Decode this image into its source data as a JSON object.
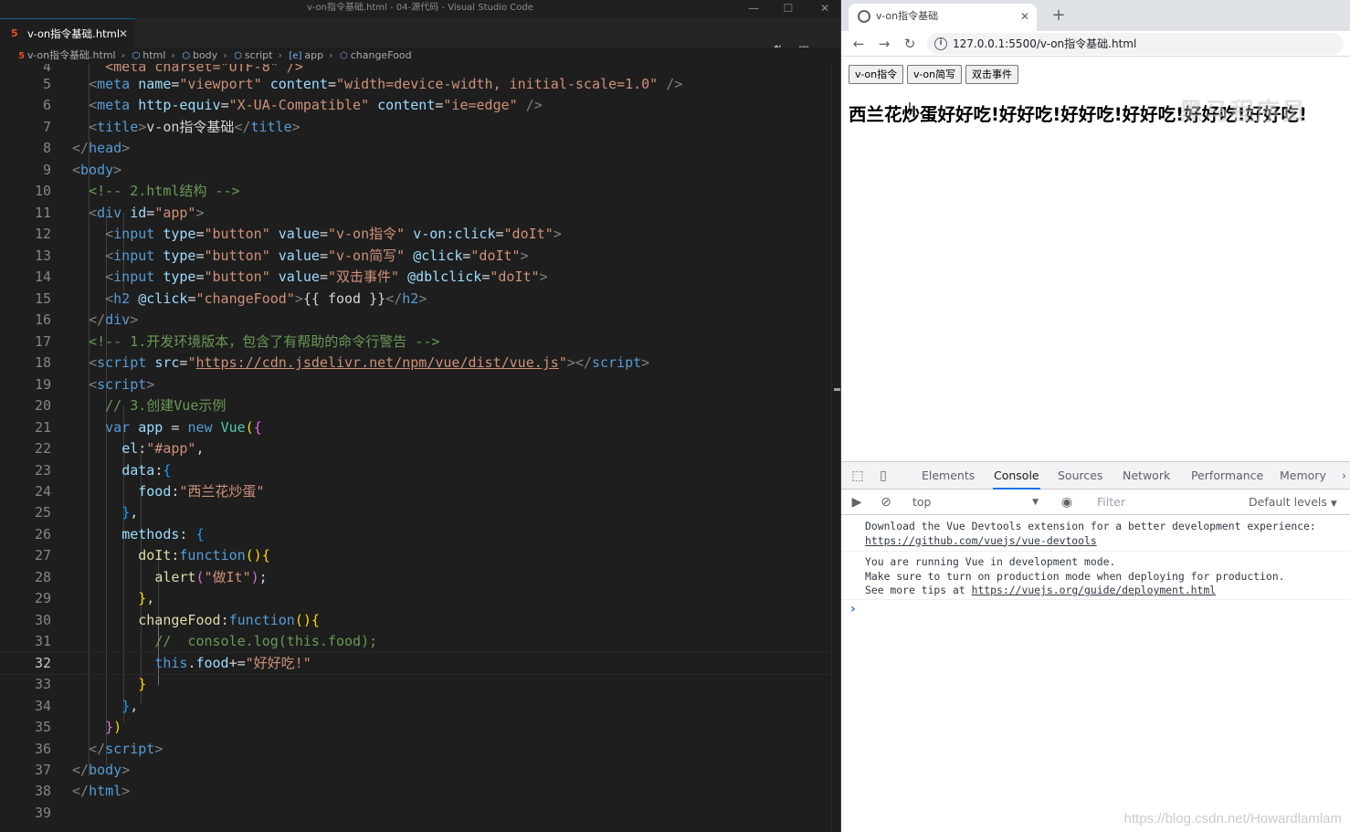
{
  "vscode": {
    "window_title": "v-on指令基础.html - 04-源代码 - Visual Studio Code",
    "tab": {
      "label": "v-on指令基础.html",
      "icon": "html5-icon"
    },
    "breadcrumb": {
      "file": "v-on指令基础.html",
      "html": "html",
      "body": "body",
      "script": "script",
      "app": "app",
      "method": "changeFood"
    },
    "current_line": 32
  },
  "code_lines": [
    {
      "n": "4"
    },
    {
      "n": "5"
    },
    {
      "n": "6"
    },
    {
      "n": "7"
    },
    {
      "n": "8"
    },
    {
      "n": "9"
    },
    {
      "n": "10"
    },
    {
      "n": "11"
    },
    {
      "n": "12"
    },
    {
      "n": "13"
    },
    {
      "n": "14"
    },
    {
      "n": "15"
    },
    {
      "n": "16"
    },
    {
      "n": "17"
    },
    {
      "n": "18"
    },
    {
      "n": "19"
    },
    {
      "n": "20"
    },
    {
      "n": "21"
    },
    {
      "n": "22"
    },
    {
      "n": "23"
    },
    {
      "n": "24"
    },
    {
      "n": "25"
    },
    {
      "n": "26"
    },
    {
      "n": "27"
    },
    {
      "n": "28"
    },
    {
      "n": "29"
    },
    {
      "n": "30"
    },
    {
      "n": "31"
    },
    {
      "n": "32"
    },
    {
      "n": "33"
    },
    {
      "n": "34"
    },
    {
      "n": "35"
    },
    {
      "n": "36"
    },
    {
      "n": "37"
    },
    {
      "n": "38"
    },
    {
      "n": "39"
    }
  ],
  "code_text": {
    "l4": "<meta charset=\"UTF-8\" />",
    "l5_a": "meta",
    "l5_b": "name",
    "l5_c": "\"viewport\"",
    "l5_d": "content",
    "l5_e": "\"width=device-width, initial-scale=1.0\"",
    "l6_a": "meta",
    "l6_b": "http-equiv",
    "l6_c": "\"X-UA-Compatible\"",
    "l6_d": "content",
    "l6_e": "\"ie=edge\"",
    "l7_a": "title",
    "l7_b": "v-on指令基础",
    "l8": "head",
    "l9": "body",
    "l10": "<!-- 2.html结构 -->",
    "l11_a": "div",
    "l11_b": "id",
    "l11_c": "\"app\"",
    "l12_a": "input",
    "l12_b": "type",
    "l12_c": "\"button\"",
    "l12_d": "value",
    "l12_e": "\"v-on指令\"",
    "l12_f": "v-on:click",
    "l12_g": "\"doIt\"",
    "l13_a": "input",
    "l13_b": "type",
    "l13_c": "\"button\"",
    "l13_d": "value",
    "l13_e": "\"v-on简写\"",
    "l13_f": "@click",
    "l13_g": "\"doIt\"",
    "l14_a": "input",
    "l14_b": "type",
    "l14_c": "\"button\"",
    "l14_d": "value",
    "l14_e": "\"双击事件\"",
    "l14_f": "@dblclick",
    "l14_g": "\"doIt\"",
    "l15_a": "h2",
    "l15_b": "@click",
    "l15_c": "\"changeFood\"",
    "l15_d": "{{ food }}",
    "l16": "div",
    "l17": "<!-- 1.开发环境版本，包含了有帮助的命令行警告 -->",
    "l18_a": "script",
    "l18_b": "src",
    "l18_c": "https://cdn.jsdelivr.net/npm/vue/dist/vue.js",
    "l19": "script",
    "l20": "// 3.创建Vue示例",
    "l21_a": "var",
    "l21_b": "app",
    "l21_c": "new",
    "l21_d": "Vue",
    "l22_a": "el",
    "l22_b": "\"#app\"",
    "l23_a": "data",
    "l24_a": "food",
    "l24_b": "\"西兰花炒蛋\"",
    "l26_a": "methods",
    "l27_a": "doIt",
    "l27_b": "function",
    "l28_a": "alert",
    "l28_b": "\"做It\"",
    "l30_a": "changeFood",
    "l30_b": "function",
    "l31": "//  console.log(this.food);",
    "l32_a": "this",
    "l32_b": "food",
    "l32_c": "\"好好吃!\"",
    "l36": "script",
    "l37": "body",
    "l38": "html"
  },
  "browser": {
    "tab_title": "v-on指令基础",
    "url": "127.0.0.1:5500/v-on指令基础.html",
    "buttons": [
      "v-on指令",
      "v-on简写",
      "双击事件"
    ],
    "heading": "西兰花炒蛋好好吃!好好吃!好好吃!好好吃!好好吃!好好吃!"
  },
  "devtools": {
    "tabs": [
      "Elements",
      "Console",
      "Sources",
      "Network",
      "Performance",
      "Memory"
    ],
    "active_tab": "Console",
    "context": "top",
    "filter_placeholder": "Filter",
    "levels": "Default levels",
    "messages": {
      "m1_line1": "Download the Vue Devtools extension for a better development experience:",
      "m1_link": "https://github.com/vuejs/vue-devtools",
      "m2_line1": "You are running Vue in development mode.",
      "m2_line2": "Make sure to turn on production mode when deploying for production.",
      "m2_line3_prefix": "See more tips at ",
      "m2_link": "https://vuejs.org/guide/deployment.html"
    }
  },
  "watermark": "https://blog.csdn.net/Howardlamlam",
  "watermark_top": "黑马程序员"
}
